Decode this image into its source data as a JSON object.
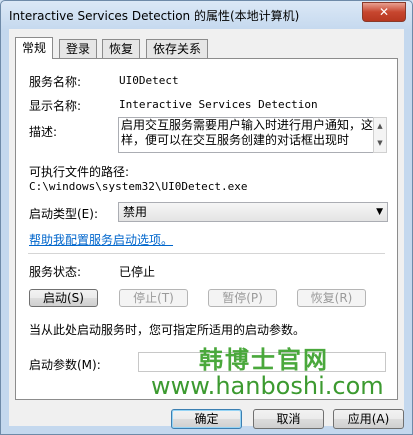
{
  "window": {
    "title": "Interactive Services Detection 的属性(本地计算机)",
    "close_glyph": "✕"
  },
  "tabs": [
    {
      "label": "常规",
      "active": true
    },
    {
      "label": "登录"
    },
    {
      "label": "恢复"
    },
    {
      "label": "依存关系"
    }
  ],
  "general": {
    "service_name_label": "服务名称:",
    "service_name": "UI0Detect",
    "display_name_label": "显示名称:",
    "display_name": "Interactive Services Detection",
    "description_label": "描述:",
    "description": "启用交互服务需要用户输入时进行用户通知，这样，便可以在交互服务创建的对话框出现时",
    "exe_path_label": "可执行文件的路径:",
    "exe_path": "C:\\windows\\system32\\UI0Detect.exe",
    "startup_type_label": "启动类型(E):",
    "startup_type": "禁用",
    "help_link": "帮助我配置服务启动选项。",
    "status_label": "服务状态:",
    "status_value": "已停止",
    "buttons": {
      "start": "启动(S)",
      "stop": "停止(T)",
      "pause": "暂停(P)",
      "resume": "恢复(R)"
    },
    "hint": "当从此处启动服务时，您可指定所适用的启动参数。",
    "params_label": "启动参数(M):",
    "params_value": ""
  },
  "footer": {
    "ok": "确定",
    "cancel": "取消",
    "apply": "应用(A)"
  },
  "watermark": {
    "line1": "韩博士官网",
    "line2": "www.hanboshi.com"
  }
}
